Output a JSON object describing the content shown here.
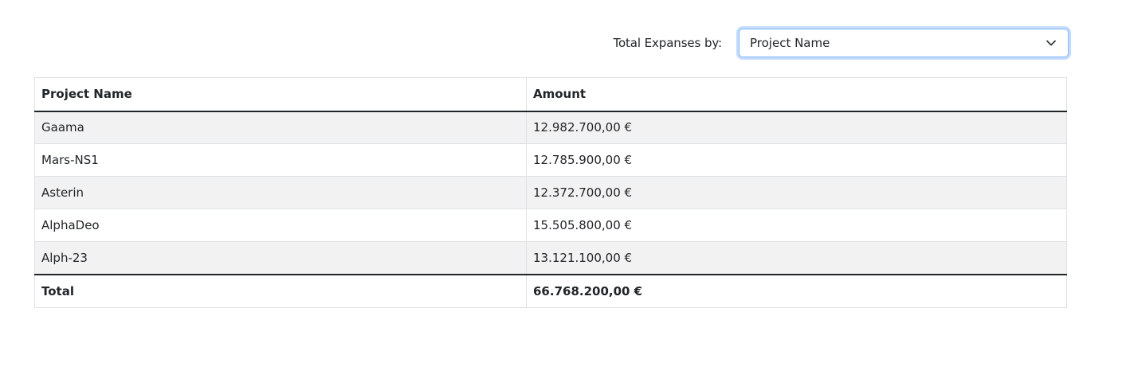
{
  "filter": {
    "label": "Total Expanses by:",
    "selected": "Project Name",
    "chevron_icon": "chevron-down-icon"
  },
  "table": {
    "headers": [
      "Project Name",
      "Amount"
    ],
    "rows": [
      {
        "project": "Gaama",
        "amount": "12.982.700,00 €"
      },
      {
        "project": "Mars-NS1",
        "amount": "12.785.900,00 €"
      },
      {
        "project": "Asterin",
        "amount": "12.372.700,00 €"
      },
      {
        "project": "AlphaDeo",
        "amount": "15.505.800,00 €"
      },
      {
        "project": "Alph-23",
        "amount": "13.121.100,00 €"
      }
    ],
    "footer": {
      "label": "Total",
      "amount": "66.768.200,00 €"
    }
  },
  "colors": {
    "focus_border": "#86b7fe",
    "stripe": "#f2f2f2",
    "text": "#212529"
  }
}
